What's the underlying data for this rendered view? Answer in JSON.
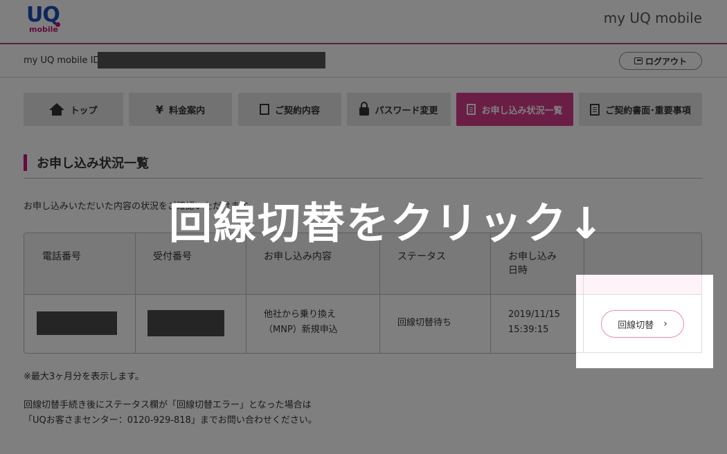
{
  "header": {
    "logo_text": "UQ",
    "logo_sub": "mobile",
    "brand_title": "my UQ mobile"
  },
  "account": {
    "id_label": "my UQ mobile ID",
    "logout_label": "ログアウト"
  },
  "nav": {
    "tabs": [
      {
        "label": "トップ",
        "icon": "home-icon"
      },
      {
        "label": "料金案内",
        "icon": "yen-icon"
      },
      {
        "label": "ご契約内容",
        "icon": "edit-icon"
      },
      {
        "label": "パスワード変更",
        "icon": "lock-icon"
      },
      {
        "label": "お申し込み状況一覧",
        "icon": "list-icon",
        "active": true
      },
      {
        "label": "ご契約書面･重要事項",
        "icon": "document-icon"
      }
    ]
  },
  "section": {
    "title": "お申し込み状況一覧",
    "intro": "お申し込みいただいた内容の状況をご確認いただけます。"
  },
  "table": {
    "headers": [
      "電話番号",
      "受付番号",
      "お申し込み内容",
      "ステータス",
      "お申し込み\n日時",
      ""
    ],
    "rows": [
      {
        "content_line1": "他社から乗り換え",
        "content_line2": "（MNP）新規申込",
        "status": "回線切替待ち",
        "date": "2019/11/15",
        "time": "15:39:15",
        "action_label": "回線切替"
      }
    ]
  },
  "notes": {
    "limit": "※最大3ヶ月分を表示します。",
    "footer_line1": "回線切替手続き後にステータス欄が「回線切替エラー」となった場合は",
    "footer_line2": "「UQお客さまセンター：0120-929-818」までお問い合わせください。"
  },
  "overlay": {
    "caption": "回線切替をクリック↓"
  },
  "colors": {
    "accent": "#d63d8a",
    "brand_blue": "#1c4fb6",
    "header_line": "#a8497a"
  }
}
